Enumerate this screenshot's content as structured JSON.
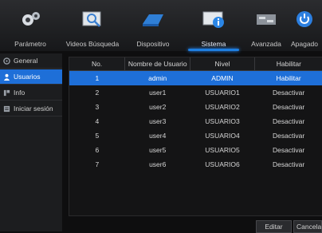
{
  "tabs": [
    {
      "label": "Parámetro",
      "icon": "gears-icon"
    },
    {
      "label": "Videos Búsqueda",
      "icon": "video-search-icon"
    },
    {
      "label": "Dispositivo",
      "icon": "hard-drive-icon"
    },
    {
      "label": "Sistema",
      "icon": "system-info-icon",
      "active": true
    },
    {
      "label": "Avanzada",
      "icon": "advanced-icon"
    },
    {
      "label": "Apagado",
      "icon": "power-icon"
    }
  ],
  "sidebar": {
    "items": [
      {
        "label": "General",
        "icon": "gear-icon"
      },
      {
        "label": "Usuarios",
        "icon": "user-icon",
        "active": true
      },
      {
        "label": "Info",
        "icon": "info-icon"
      },
      {
        "label": "Iniciar sesión",
        "icon": "log-icon"
      }
    ]
  },
  "table": {
    "headers": [
      "No.",
      "Nombre de Usuario",
      "Nivel",
      "Habilitar"
    ],
    "rows": [
      [
        "1",
        "admin",
        "ADMIN",
        "Habilitar"
      ],
      [
        "2",
        "user1",
        "USUARIO1",
        "Desactivar"
      ],
      [
        "3",
        "user2",
        "USUARIO2",
        "Desactivar"
      ],
      [
        "4",
        "user3",
        "USUARIO3",
        "Desactivar"
      ],
      [
        "5",
        "user4",
        "USUARIO4",
        "Desactivar"
      ],
      [
        "6",
        "user5",
        "USUARIO5",
        "Desactivar"
      ],
      [
        "7",
        "user6",
        "USUARIO6",
        "Desactivar"
      ]
    ]
  },
  "buttons": {
    "edit": "Editar",
    "cancel": "Cancelar"
  },
  "colors": {
    "accent": "#1e6fd8",
    "background": "#0e0e0f"
  }
}
